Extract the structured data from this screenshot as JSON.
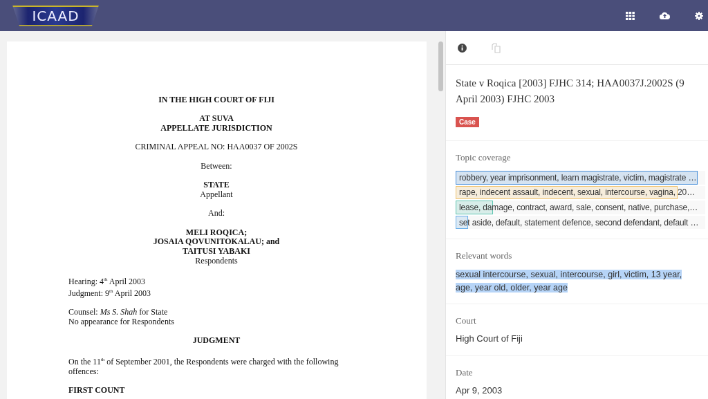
{
  "header": {
    "logo": "ICAAD"
  },
  "document": {
    "blocks": [
      {
        "lines": [
          {
            "kind": "heading",
            "text": "IN THE HIGH COURT OF FIJI"
          }
        ]
      },
      {
        "lines": [
          {
            "kind": "heading",
            "text": "AT SUVA"
          },
          {
            "kind": "heading",
            "text": "APPELLATE JURISDICTION"
          }
        ]
      },
      {
        "lines": [
          {
            "kind": "center",
            "text": "CRIMINAL APPEAL NO: HAA0037 OF 2002S"
          }
        ]
      },
      {
        "lines": [
          {
            "kind": "center",
            "text": "Between:"
          }
        ]
      },
      {
        "lines": [
          {
            "kind": "heading",
            "text": "STATE"
          },
          {
            "kind": "center",
            "text": "Appellant"
          }
        ]
      },
      {
        "lines": [
          {
            "kind": "center",
            "text": "And:"
          }
        ]
      },
      {
        "lines": [
          {
            "kind": "heading",
            "text": "MELI ROQICA;"
          },
          {
            "kind": "heading",
            "text": "JOSAIA QOVUNITOKALAU; and"
          },
          {
            "kind": "heading",
            "text": "TAITUSI YABAKI"
          },
          {
            "kind": "center",
            "text": "Respondents"
          }
        ]
      },
      {
        "lines": [
          {
            "kind": "left",
            "text": "Hearing: 4$^{th}$ April 2003"
          },
          {
            "kind": "left",
            "text": "Judgment: 9$^{th}$ April 2003"
          }
        ]
      },
      {
        "lines": [
          {
            "kind": "left",
            "text": "Counsel: *Ms S. Shah* for State"
          },
          {
            "kind": "left",
            "text": "No appearance for Respondents"
          }
        ]
      },
      {
        "lines": [
          {
            "kind": "heading",
            "text": "JUDGMENT"
          }
        ]
      },
      {
        "lines": [
          {
            "kind": "paragraph",
            "text": "On the 11$^{th}$ of September 2001, the Respondents were charged with the following offences:"
          }
        ]
      },
      {
        "lines": [
          {
            "kind": "left-heading",
            "text": "FIRST COUNT"
          }
        ]
      }
    ]
  },
  "panel": {
    "tabs": [
      {
        "selected": true
      },
      {
        "selected": false
      }
    ],
    "title": "State v Roqica [2003] FJHC 314; HAA0037J.2002S (9 April 2003) FJHC 2003",
    "badge": "Case",
    "topic_coverage": {
      "label": "Topic coverage",
      "topics": [
        {
          "text": "robbery, year imprisonment, learn magistrate, victim, magistrate …",
          "level": 0.97,
          "color": "#4a90d9"
        },
        {
          "text": "rape, indecent assault, indecent, sexual, intercourse, vagina, 20…",
          "level": 0.89,
          "color": "#f0c36d"
        },
        {
          "text": "lease, damage, contract, award, sale, consent, native, purchase,…",
          "level": 0.15,
          "color": "#5cc4b0"
        },
        {
          "text": "set aside, default, statement defence, second defendant, default …",
          "level": 0.05,
          "color": "#6aaee8"
        }
      ]
    },
    "relevant_words": {
      "label": "Relevant words",
      "text": "sexual intercourse, sexual, intercourse, girl, victim, 13 year, age, year old, older, year age"
    },
    "fields": [
      {
        "label": "Court",
        "value": "High Court of Fiji"
      },
      {
        "label": "Date",
        "value": "Apr 9, 2003"
      }
    ]
  }
}
